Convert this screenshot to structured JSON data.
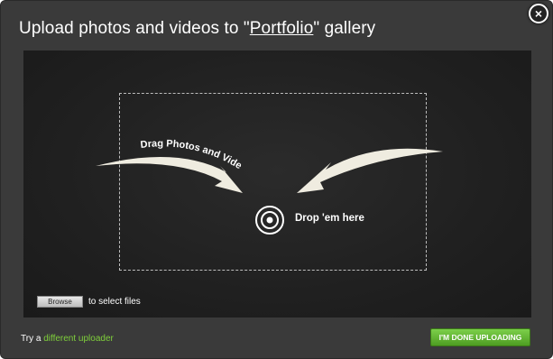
{
  "dialog": {
    "title_prefix": "Upload photos and videos to \"",
    "gallery_name": "Portfolio",
    "title_suffix": "\" gallery",
    "close_label": "×"
  },
  "drop_zone": {
    "drag_label": "Drag Photos and Videos",
    "drop_label": "Drop 'em here"
  },
  "browse": {
    "button_label": "Browse",
    "hint": "to select files"
  },
  "footer": {
    "try_text": "Try a ",
    "alt_link": "different uploader",
    "done_label": "I'M DONE UPLOADING"
  },
  "colors": {
    "accent_green": "#7fcf3b",
    "button_green": "#5aaa2a",
    "panel_bg": "#202020",
    "dialog_bg": "#3a3a3a"
  }
}
